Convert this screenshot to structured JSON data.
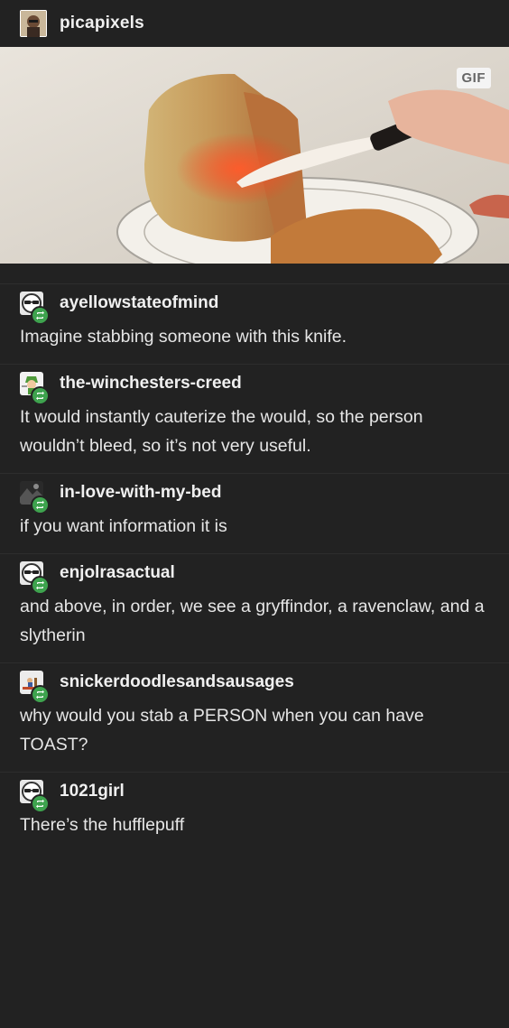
{
  "post": {
    "author": "picapixels",
    "gif_badge": "GIF"
  },
  "replies": [
    {
      "username": "ayellowstateofmind",
      "text": "Imagine stabbing someone with this knife.",
      "avatar_icon": "sunglasses-face-icon"
    },
    {
      "username": "the-winchesters-creed",
      "text": "It would instantly cauterize the would, so the person wouldn’t bleed, so it’s not very useful.",
      "avatar_icon": "link-character-icon"
    },
    {
      "username": "in-love-with-my-bed",
      "text": "if you want information it is",
      "avatar_icon": "dark-photo-icon"
    },
    {
      "username": "enjolrasactual",
      "text": "and above, in order, we see a gryffindor, a ravenclaw, and a slytherin",
      "avatar_icon": "sunglasses-face-icon"
    },
    {
      "username": "snickerdoodlesandsausages",
      "text": "why would you stab a PERSON when you can have TOAST?",
      "avatar_icon": "cartoon-figure-icon"
    },
    {
      "username": "1021girl",
      "text": "There’s the hufflepuff",
      "avatar_icon": "sunglasses-face-icon"
    }
  ],
  "colors": {
    "background": "#222222",
    "divider": "#2d2d2d",
    "reblog_badge": "#3ea34e",
    "text": "#e6e6e6"
  }
}
